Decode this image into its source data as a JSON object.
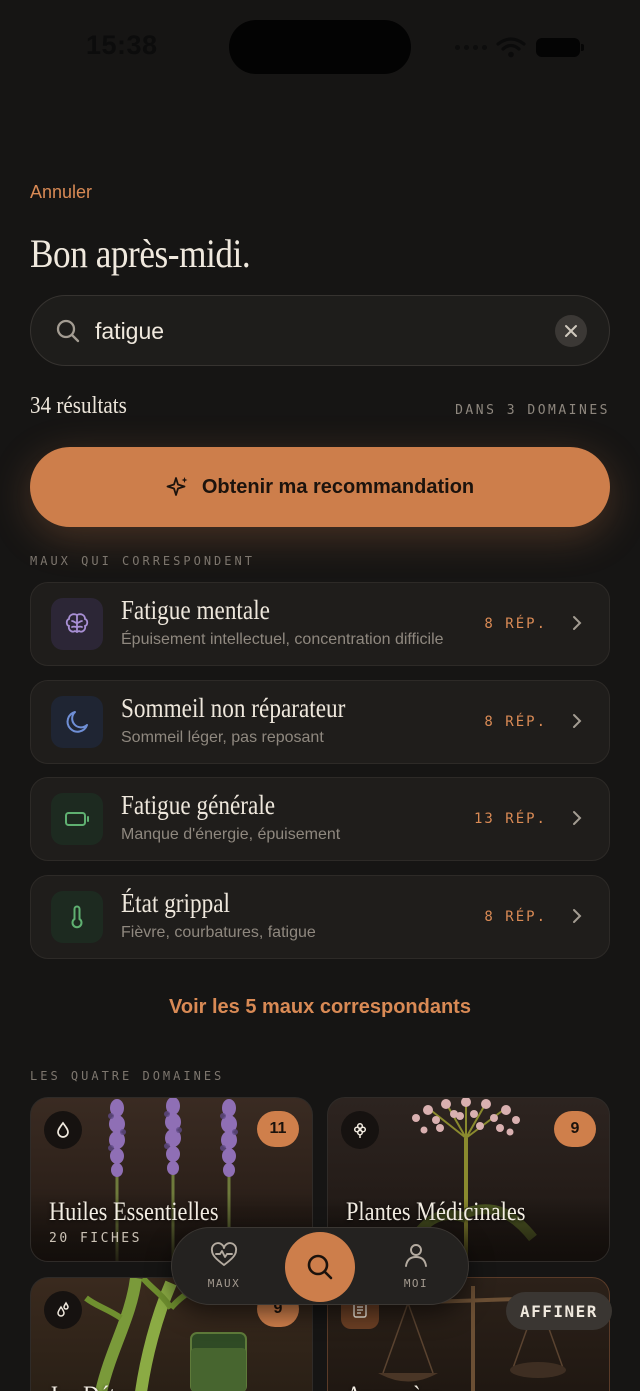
{
  "status_bar": {
    "time": "15:38"
  },
  "header": {
    "cancel": "Annuler",
    "greeting": "Bon après-midi."
  },
  "search": {
    "value": "fatigue",
    "placeholder": ""
  },
  "results": {
    "count": "34 résultats",
    "domains": "DANS 3 DOMAINES"
  },
  "cta": {
    "label": "Obtenir ma recommandation"
  },
  "ailments": {
    "section_label": "MAUX QUI CORRESPONDENT",
    "items": [
      {
        "title": "Fatigue mentale",
        "subtitle": "Épuisement intellectuel, concentration difficile",
        "count": "8 RÉP.",
        "icon": "brain-icon",
        "color": "#a88fd4"
      },
      {
        "title": "Sommeil non réparateur",
        "subtitle": "Sommeil léger, pas reposant",
        "count": "8 RÉP.",
        "icon": "moon-icon",
        "color": "#6f8fd6"
      },
      {
        "title": "Fatigue générale",
        "subtitle": "Manque d'énergie, épuisement",
        "count": "13 RÉP.",
        "icon": "battery-icon",
        "color": "#5fb071"
      },
      {
        "title": "État grippal",
        "subtitle": "Fièvre, courbatures, fatigue",
        "count": "8 RÉP.",
        "icon": "thermometer-icon",
        "color": "#5fb071"
      }
    ],
    "see_all": "Voir les 5 maux correspondants"
  },
  "domains": {
    "section_label": "LES QUATRE DOMAINES",
    "cards": [
      {
        "title": "Huiles Essentielles",
        "subtitle": "20 FICHES",
        "count": "11",
        "icon": "droplet-icon"
      },
      {
        "title": "Plantes Médicinales",
        "subtitle": "",
        "count": "9",
        "icon": "flower-icon"
      },
      {
        "title": "Jus Détox",
        "subtitle": "",
        "count": "9",
        "icon": "drops-icon"
      },
      {
        "title": "Anamnèse",
        "subtitle": "",
        "count": "",
        "icon": "list-icon"
      }
    ]
  },
  "nav": {
    "items": [
      {
        "label": "MAUX",
        "icon": "heart-pulse-icon"
      },
      {
        "label": "",
        "icon": "search-icon"
      },
      {
        "label": "MOI",
        "icon": "user-icon"
      }
    ]
  },
  "refine": {
    "label": "AFFINER"
  },
  "colors": {
    "accent": "#cd7e4b",
    "background": "#161514",
    "card": "#1f1d1b"
  }
}
